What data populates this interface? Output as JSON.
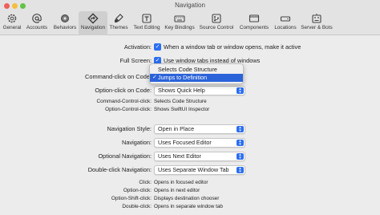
{
  "window": {
    "title": "Navigation"
  },
  "toolbar": {
    "items": [
      {
        "label": "General",
        "icon": "gear-icon"
      },
      {
        "label": "Accounts",
        "icon": "at-icon"
      },
      {
        "label": "Behaviors",
        "icon": "gear-settings-icon"
      },
      {
        "label": "Navigation",
        "icon": "navigation-diamond-icon",
        "selected": true
      },
      {
        "label": "Themes",
        "icon": "paintbrush-icon"
      },
      {
        "label": "Text Editing",
        "icon": "text-editing-icon"
      },
      {
        "label": "Key Bindings",
        "icon": "keyboard-icon"
      },
      {
        "label": "Source Control",
        "icon": "source-control-icon"
      },
      {
        "label": "Components",
        "icon": "components-icon"
      },
      {
        "label": "Locations",
        "icon": "hard-drive-icon"
      },
      {
        "label": "Server & Bots",
        "icon": "server-icon"
      }
    ]
  },
  "settings": {
    "activation": {
      "label": "Activation:",
      "text": "When a window tab or window opens, make it active"
    },
    "full_screen": {
      "label": "Full Screen:",
      "text": "Use window tabs instead of windows"
    },
    "command_click": {
      "label": "Command-click on Code:"
    },
    "command_click_menu": {
      "option1": "Selects Code Structure",
      "option2": "Jumps to Definition",
      "checkmark": "✓"
    },
    "option_click": {
      "label": "Option-click on Code:",
      "value": "Shows Quick Help"
    },
    "cmd_ctrl_click": {
      "label": "Command-Control-click:",
      "value": "Selects Code Structure"
    },
    "opt_ctrl_click": {
      "label": "Option-Control-click:",
      "value": "Shows SwiftUI Inspector"
    },
    "navigation_style": {
      "label": "Navigation Style:",
      "value": "Open in Place"
    },
    "navigation": {
      "label": "Navigation:",
      "value": "Uses Focused Editor"
    },
    "optional_navigation": {
      "label": "Optional Navigation:",
      "value": "Uses Next Editor"
    },
    "double_click_navigation": {
      "label": "Double-click Navigation:",
      "value": "Uses Separate Window Tab"
    },
    "click": {
      "label": "Click:",
      "value": "Opens in focused editor"
    },
    "option_click_sum": {
      "label": "Option-click:",
      "value": "Opens in next editor"
    },
    "option_shift_click": {
      "label": "Option-Shift-click:",
      "value": "Displays destination chooser"
    },
    "double_click": {
      "label": "Double-click:",
      "value": "Opens in separate window tab"
    }
  },
  "colors": {
    "accent": "#2b6ef2",
    "menu_highlight": "#2b63d9"
  }
}
